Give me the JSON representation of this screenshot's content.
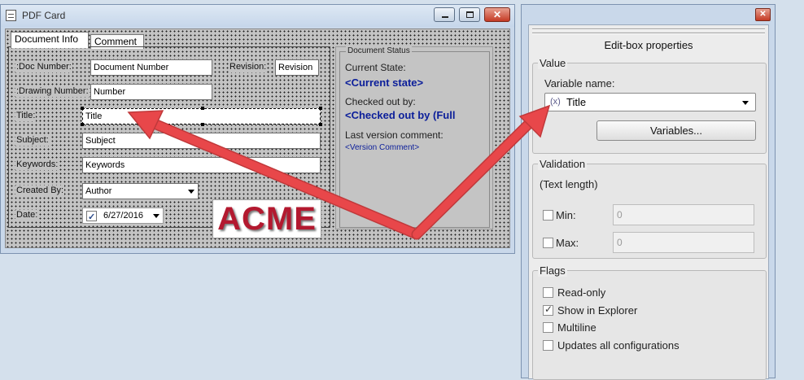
{
  "card_window": {
    "title": "PDF Card",
    "buttons": {
      "minimize": "",
      "maximize": "",
      "close": "✕"
    },
    "tabs": [
      {
        "label": "Document Info"
      },
      {
        "label": "Comment"
      }
    ],
    "fields": {
      "doc_number": {
        "label": ":Doc Number:",
        "value": "Document Number"
      },
      "revision": {
        "label": "Revision:",
        "value": "Revision"
      },
      "drawing_number": {
        "label": ":Drawing Number:",
        "value": "Number"
      },
      "title": {
        "label": "Title:",
        "value": "Title"
      },
      "subject": {
        "label": "Subject:",
        "value": "Subject"
      },
      "keywords": {
        "label": "Keywords:",
        "value": "Keywords"
      },
      "created_by": {
        "label": "Created By:",
        "value": "Author"
      },
      "date": {
        "label": "Date:",
        "value": "6/27/2016",
        "checked": true
      }
    },
    "logo_text": "ACME",
    "status": {
      "legend": "Document Status",
      "current_state_label": "Current State:",
      "current_state_value": "<Current state>",
      "checked_out_label": "Checked out by:",
      "checked_out_value": "<Checked out by (Full",
      "last_comment_label": "Last version comment:",
      "last_comment_value": "<Version Comment>"
    }
  },
  "properties_panel": {
    "close_label": "✕",
    "header": "Edit-box properties",
    "value_group": {
      "title": "Value",
      "variable_name_label": "Variable name:",
      "variable_icon": "(x)",
      "variable_selected": "Title",
      "variables_button": "Variables..."
    },
    "validation_group": {
      "title": "Validation",
      "text_length_label": "(Text length)",
      "min_label": "Min:",
      "min_value": "0",
      "max_label": "Max:",
      "max_value": "0"
    },
    "flags_group": {
      "title": "Flags",
      "items": [
        {
          "label": "Read-only",
          "checked": false
        },
        {
          "label": "Show in Explorer",
          "checked": true
        },
        {
          "label": "Multiline",
          "checked": false
        },
        {
          "label": "Updates all configurations",
          "checked": false
        }
      ]
    }
  },
  "colors": {
    "arrow": "#e8474a",
    "accent_text": "#0b1e9a",
    "logo": "#b3192f"
  }
}
